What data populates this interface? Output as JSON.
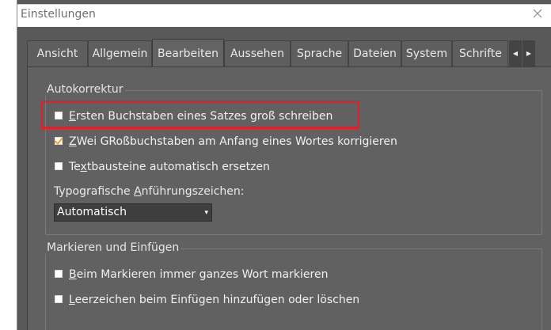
{
  "window": {
    "title": "Einstellungen"
  },
  "tabs": [
    {
      "label": "Ansicht"
    },
    {
      "label": "Allgemein"
    },
    {
      "label": "Bearbeiten",
      "active": true
    },
    {
      "label": "Aussehen"
    },
    {
      "label": "Sprache"
    },
    {
      "label": "Dateien"
    },
    {
      "label": "System"
    },
    {
      "label": "Schrifte"
    }
  ],
  "tab_scroll": {
    "left": "◀",
    "right": "▶"
  },
  "autokorrektur": {
    "title": "Autokorrektur",
    "options": [
      {
        "accel": "E",
        "rest": "rsten Buchstaben eines Satzes groß schreiben",
        "checked": false
      },
      {
        "accel": "Z",
        "rest": "Wei GRoßbuchstaben am Anfang eines Wortes korrigieren",
        "checked": true
      },
      {
        "pre": "Te",
        "accel": "x",
        "rest": "tbausteine automatisch ersetzen",
        "checked": false
      }
    ],
    "quotes_label_pre": "Typografische ",
    "quotes_label_accel": "A",
    "quotes_label_rest": "nführungszeichen:",
    "quotes_value": "Automatisch",
    "quotes_arrow": "▾"
  },
  "markieren": {
    "title": "Markieren und Einfügen",
    "options": [
      {
        "accel": "B",
        "rest": "eim Markieren immer ganzes Wort markieren",
        "checked": false
      },
      {
        "accel": "L",
        "rest": "eerzeichen beim Einfügen hinzufügen oder löschen",
        "checked": false
      }
    ]
  },
  "colors": {
    "highlight": "#e0202a",
    "check_accent": "#f0a030"
  }
}
